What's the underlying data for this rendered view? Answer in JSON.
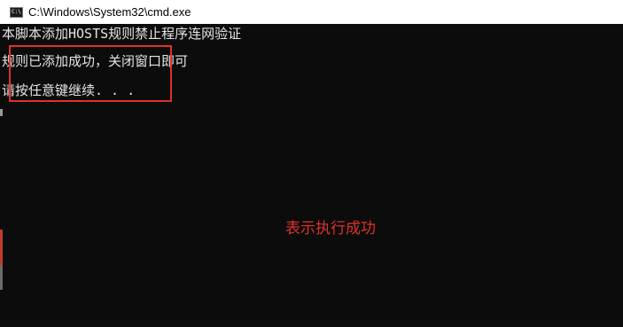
{
  "window": {
    "title": "C:\\Windows\\System32\\cmd.exe",
    "icon_name": "cmd-icon",
    "icon_glyph": "C:\\"
  },
  "console": {
    "lines": [
      "本脚本添加HOSTS规则禁止程序连网验证",
      "规则已添加成功，关闭窗口即可",
      "请按任意键继续. . ."
    ]
  },
  "annotation": {
    "text": "表示执行成功",
    "color": "#e0312b"
  },
  "colors": {
    "console_background": "#0c0c0c",
    "console_text": "#e4e4e4",
    "highlight": "#e0312b"
  }
}
